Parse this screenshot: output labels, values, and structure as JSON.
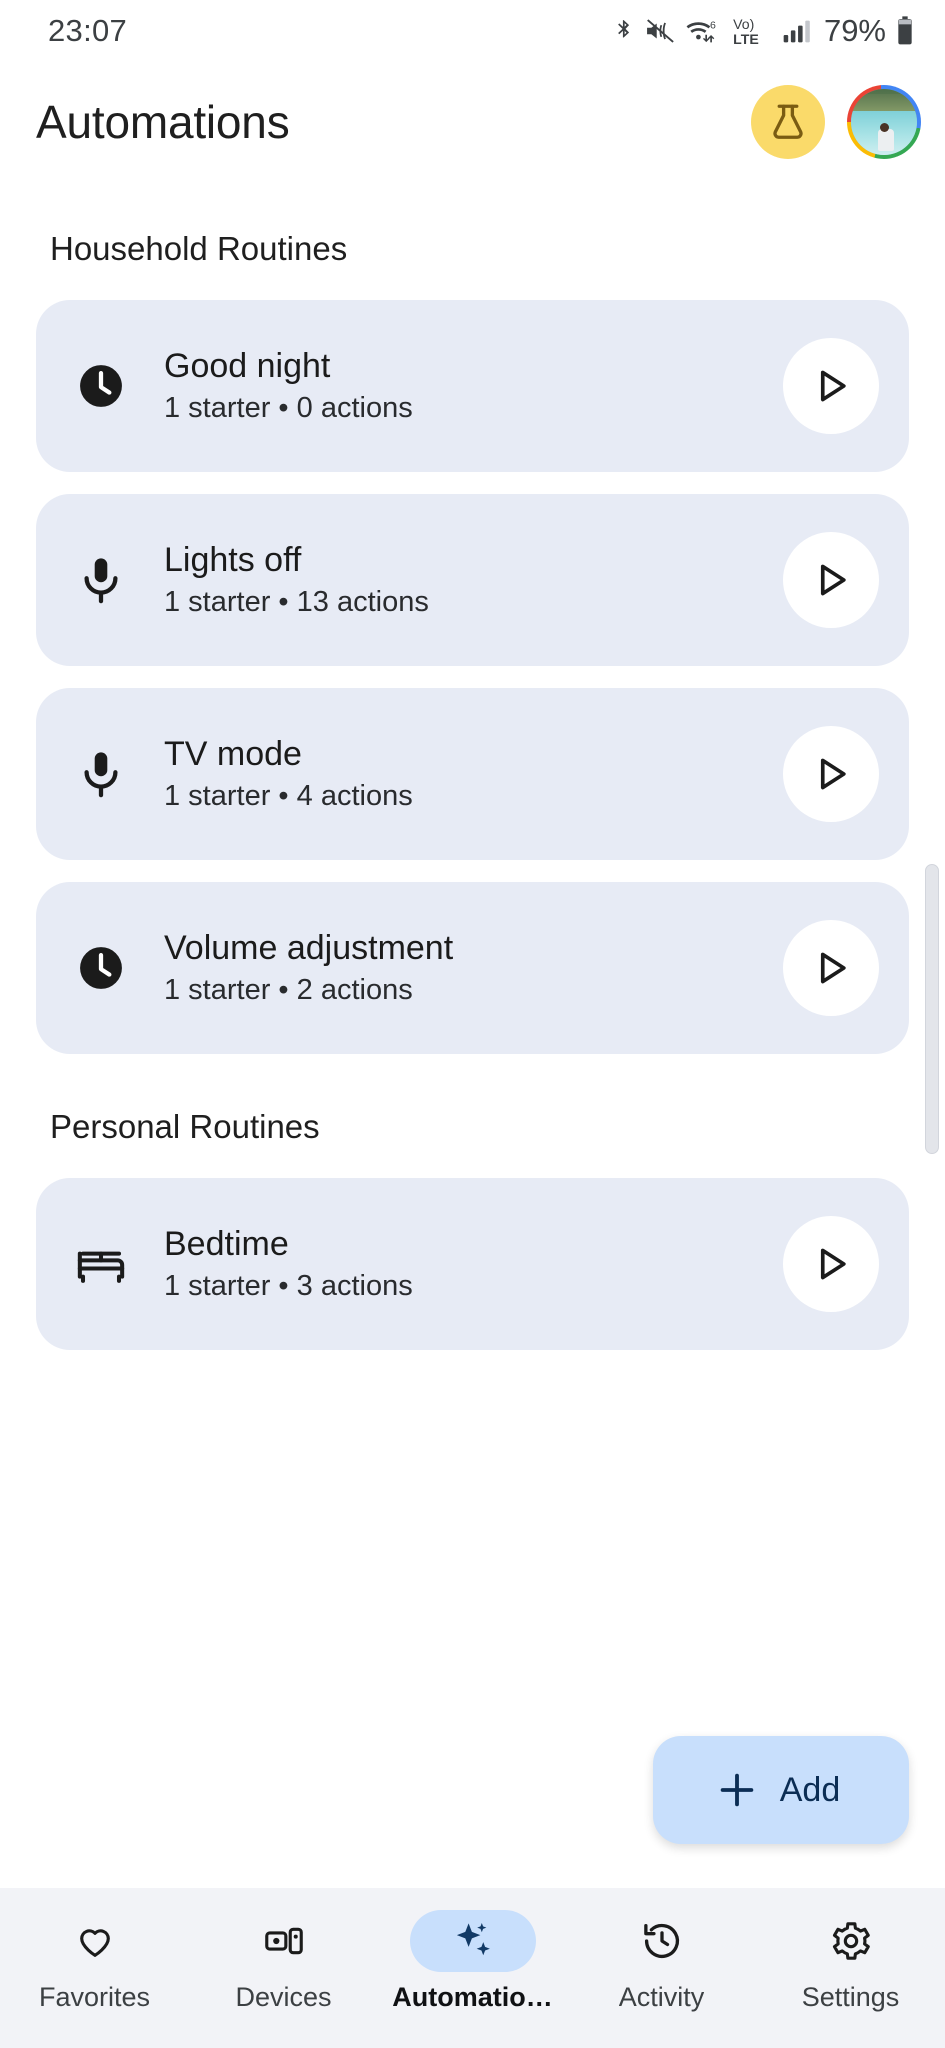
{
  "status_bar": {
    "time": "23:07",
    "battery_percent": "79%",
    "icons": [
      "bluetooth-icon",
      "ringer-vibrate-off-icon",
      "wifi-6-icon",
      "volte-icon",
      "cellular-signal-icon",
      "battery-icon"
    ]
  },
  "app_bar": {
    "title": "Automations",
    "flask_icon": "flask-icon",
    "flask_bg": "#fada6a",
    "avatar_icon": "avatar"
  },
  "sections": [
    {
      "title": "Household Routines",
      "routines": [
        {
          "name": "Good night",
          "subtitle": "1 starter • 0 actions",
          "icon": "clock-filled-icon",
          "play": "play-icon"
        },
        {
          "name": "Lights off",
          "subtitle": "1 starter • 13 actions",
          "icon": "microphone-icon",
          "play": "play-icon"
        },
        {
          "name": "TV mode",
          "subtitle": "1 starter • 4 actions",
          "icon": "microphone-icon",
          "play": "play-icon"
        },
        {
          "name": "Volume adjustment",
          "subtitle": "1 starter • 2 actions",
          "icon": "clock-filled-icon",
          "play": "play-icon"
        }
      ]
    },
    {
      "title": "Personal Routines",
      "routines": [
        {
          "name": "Bedtime",
          "subtitle": "1 starter • 3 actions",
          "icon": "bed-icon",
          "play": "play-icon"
        }
      ]
    }
  ],
  "fab": {
    "label": "Add",
    "icon": "plus-icon",
    "bg": "#c8dffc",
    "fg": "#0b2d54"
  },
  "bottom_nav": {
    "items": [
      {
        "label": "Favorites",
        "icon": "heart-icon",
        "active": false
      },
      {
        "label": "Devices",
        "icon": "devices-icon",
        "active": false
      },
      {
        "label": "Automatio…",
        "icon": "sparkle-icon",
        "active": true
      },
      {
        "label": "Activity",
        "icon": "history-icon",
        "active": false
      },
      {
        "label": "Settings",
        "icon": "gear-icon",
        "active": false
      }
    ],
    "active_pill_color": "#c8dffc"
  },
  "colors": {
    "card_bg": "#e7ebf5",
    "page_bg": "#ffffff",
    "nav_bg": "#f2f3f7"
  }
}
